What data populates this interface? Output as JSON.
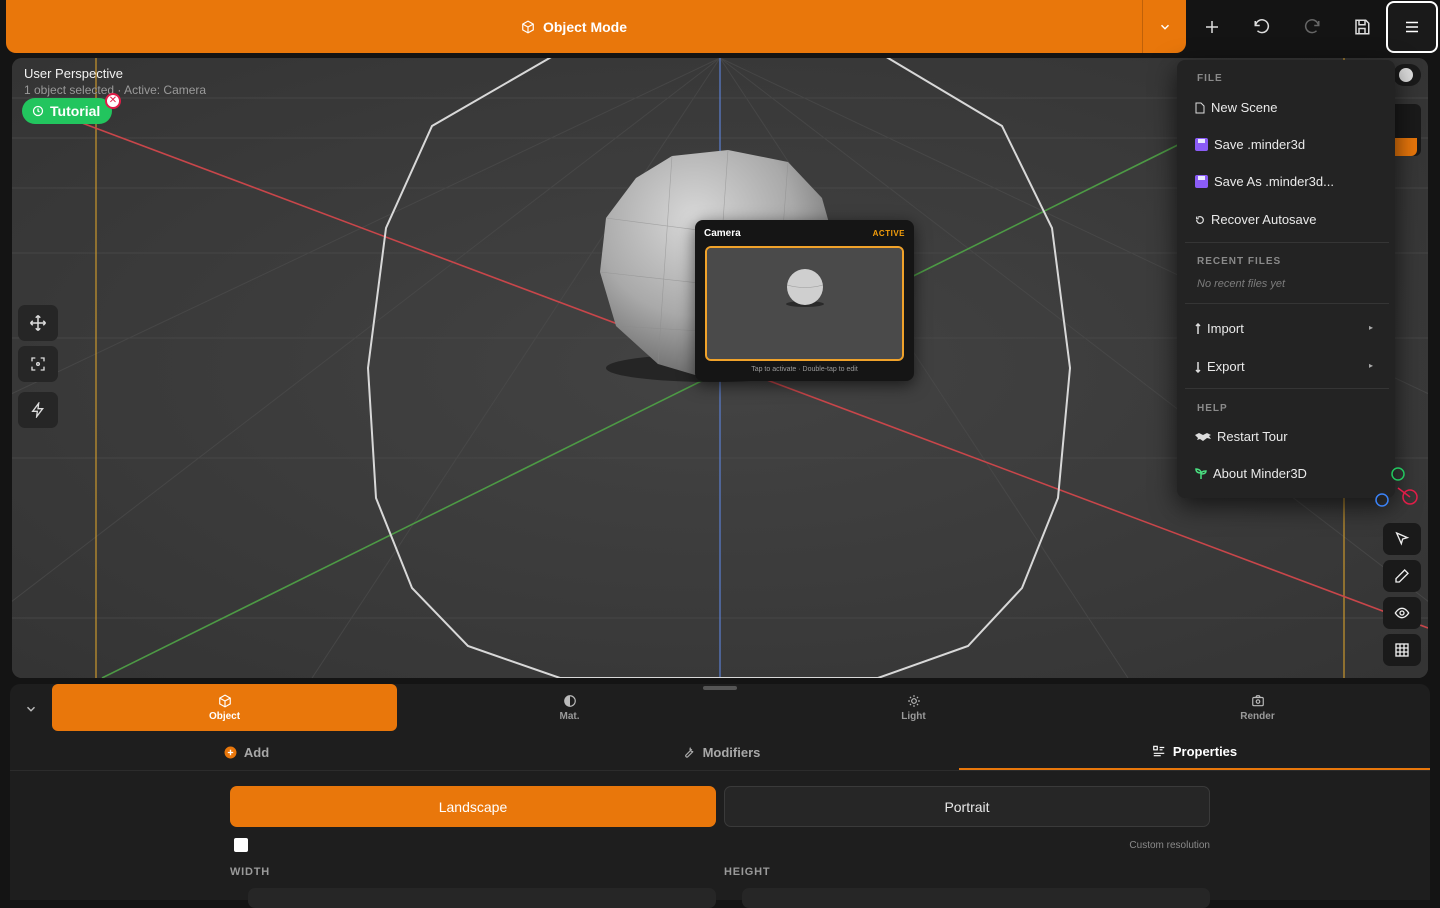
{
  "topbar": {
    "mode_label": "Object Mode",
    "accent": "#e9770b"
  },
  "viewport": {
    "title": "User Perspective",
    "subtitle": "1 object selected · Active: Camera",
    "tutorial_label": "Tutorial"
  },
  "camera_preview": {
    "title": "Camera",
    "badge": "ACTIVE",
    "hint": "Tap to activate · Double-tap to edit"
  },
  "file_menu": {
    "file_section": "FILE",
    "new_scene": "New Scene",
    "save": "Save .minder3d",
    "save_as": "Save As .minder3d...",
    "recover": "Recover Autosave",
    "recent_section": "RECENT FILES",
    "recent_empty": "No recent files yet",
    "import": "Import",
    "export": "Export",
    "help_section": "HELP",
    "restart_tour": "Restart Tour",
    "about": "About Minder3D"
  },
  "bottom_panel": {
    "tabs": [
      {
        "label": "Object",
        "icon": "cube-icon"
      },
      {
        "label": "Mat.",
        "icon": "half-circle-icon"
      },
      {
        "label": "Light",
        "icon": "sun-icon"
      },
      {
        "label": "Render",
        "icon": "camera-icon"
      }
    ],
    "subtabs": {
      "add": "Add",
      "modifiers": "Modifiers",
      "properties": "Properties"
    },
    "landscape": "Landscape",
    "portrait": "Portrait",
    "custom_resolution": "Custom resolution",
    "width_label": "WIDTH",
    "height_label": "HEIGHT"
  }
}
